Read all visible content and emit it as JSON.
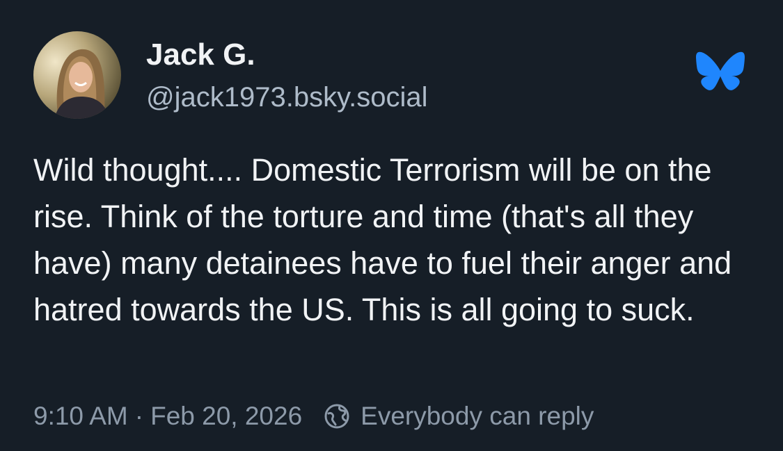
{
  "post": {
    "author": {
      "display_name": "Jack G.",
      "handle": "@jack1973.bsky.social"
    },
    "text": "Wild thought....  Domestic Terrorism will be on the rise. Think of the torture and time (that's all they have) many detainees have to fuel their anger and hatred towards the US. This is all going to suck.",
    "time": "9:10 AM",
    "separator": "·",
    "date": "Feb 20, 2026",
    "reply_setting": "Everybody can reply"
  },
  "colors": {
    "background": "#161e27",
    "text_primary": "#f1f3f5",
    "text_secondary": "#8d9aa9",
    "bluesky_brand": "#1f86fd"
  },
  "icons": {
    "logo": "bluesky-butterfly-icon",
    "reply": "globe-icon"
  }
}
